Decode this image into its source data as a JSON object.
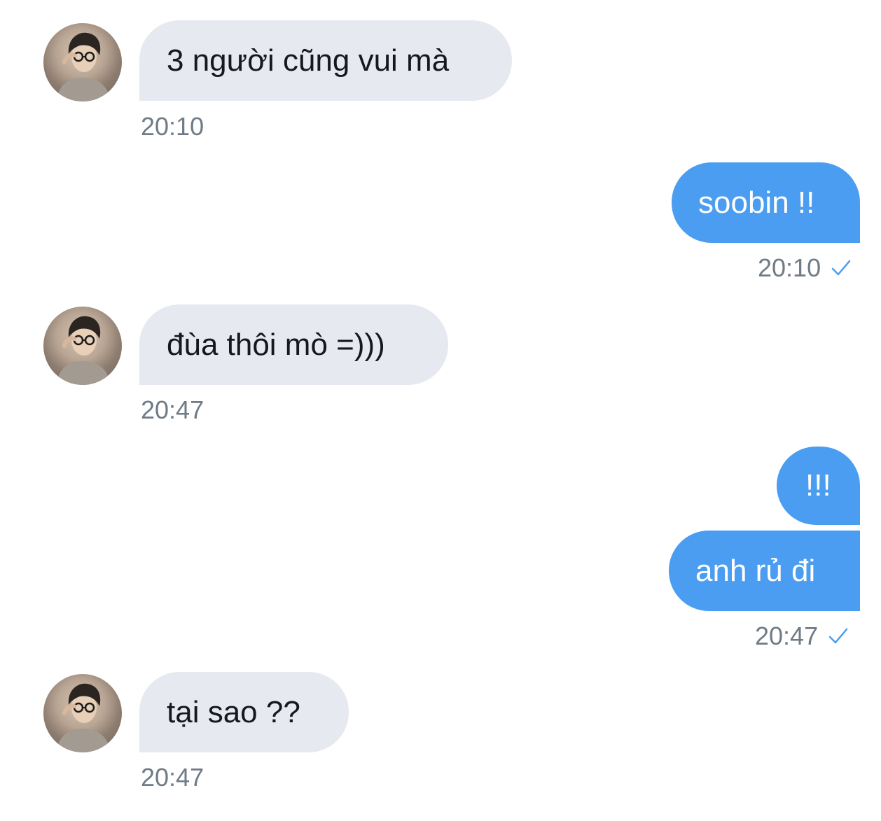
{
  "colors": {
    "incoming_bubble": "#e6e9ef",
    "outgoing_bubble": "#4a9df0",
    "timestamp": "#6f7b86",
    "read_check": "#4a9df0"
  },
  "avatar": {
    "icon": "user-avatar-photo"
  },
  "messages": [
    {
      "direction": "incoming",
      "text": "3 người cũng vui mà",
      "time": "20:10"
    },
    {
      "direction": "outgoing",
      "text": "soobin !!",
      "time": "20:10",
      "status_icon": "read-check-icon"
    },
    {
      "direction": "incoming",
      "text": "đùa thôi mò =)))",
      "time": "20:47"
    },
    {
      "direction": "outgoing",
      "text": "!!!"
    },
    {
      "direction": "outgoing",
      "text": "anh rủ đi",
      "time": "20:47",
      "status_icon": "read-check-icon"
    },
    {
      "direction": "incoming",
      "text": "tại sao ??",
      "time": "20:47"
    }
  ]
}
